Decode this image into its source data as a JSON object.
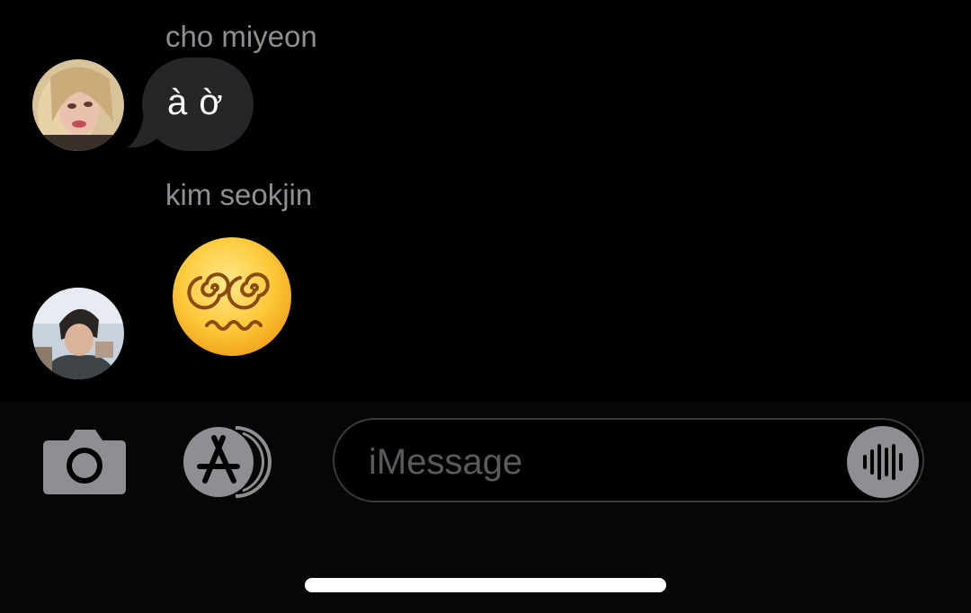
{
  "conversation": {
    "messages": [
      {
        "sender": "cho miyeon",
        "type": "text",
        "text": "à ờ",
        "avatar_icon": "avatar-photo-cho-miyeon"
      },
      {
        "sender": "kim seokjin",
        "type": "emoji",
        "emoji_icon": "face-with-spiral-eyes-emoji",
        "avatar_icon": "avatar-photo-kim-seokjin"
      }
    ]
  },
  "composer": {
    "placeholder": "iMessage",
    "value": "",
    "camera_icon": "camera-icon",
    "apps_icon": "app-store-icon",
    "audio_icon": "audio-waveform-icon"
  },
  "colors": {
    "background": "#000000",
    "bubble_received": "#262628",
    "sender_name": "#8e8e93",
    "icon_gray": "#8e8e93",
    "field_border": "#3a3a3c",
    "placeholder": "#5a5a5e"
  }
}
